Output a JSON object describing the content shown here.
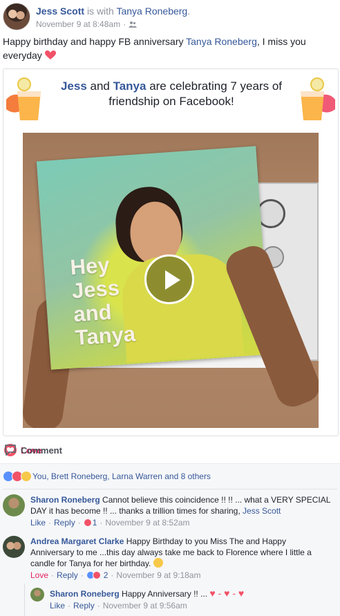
{
  "header": {
    "author": "Jess Scott",
    "with_text": "is with",
    "tagged": "Tanya Roneberg",
    "period": ".",
    "timestamp": "November 9 at 8:48am",
    "audience_icon": "friends-icon"
  },
  "post": {
    "text_before": "Happy birthday and happy FB anniversary ",
    "mention": "Tanya Roneberg",
    "text_after": ", I miss you everyday ",
    "emoji": "heart-icon"
  },
  "card": {
    "name1": "Jess",
    "and1": " and ",
    "name2": "Tanya",
    "title_rest": " are celebrating 7 years of friendship on Facebook!",
    "video_text": [
      "Hey",
      "Jess",
      "and",
      "Tanya"
    ]
  },
  "actions": {
    "love_label": "Love",
    "comment_label": "Comment"
  },
  "reactions": {
    "summary": "You, Brett Roneberg, Larna Warren and 8 others"
  },
  "comments": [
    {
      "author": "Sharon Roneberg",
      "text": " Cannot believe this coincidence !! !! ... what a VERY SPECIAL DAY it has become !! ... thanks a trillion times for sharing, ",
      "mention": "Jess Scott",
      "like": "Like",
      "reply": "Reply",
      "reaction_count": "1",
      "time": "November 9 at 8:52am"
    },
    {
      "author": "Andrea Margaret Clarke",
      "text": " Happy Birthday to you Miss The and Happy Anniversary to me ...this day always take me back to Florence where I little a candle for Tanya for her birthday. ",
      "like": "Love",
      "reply": "Reply",
      "reaction_count": "2",
      "time": "November 9 at 9:18am"
    },
    {
      "author": "Sharon Roneberg",
      "text": " Happy Anniversary !! ... ",
      "like": "Like",
      "reply": "Reply",
      "time": "November 9 at 9:56am"
    }
  ],
  "separator": " · ",
  "colors": {
    "link": "#365899",
    "love": "#e0245e",
    "meta": "#90949c"
  }
}
